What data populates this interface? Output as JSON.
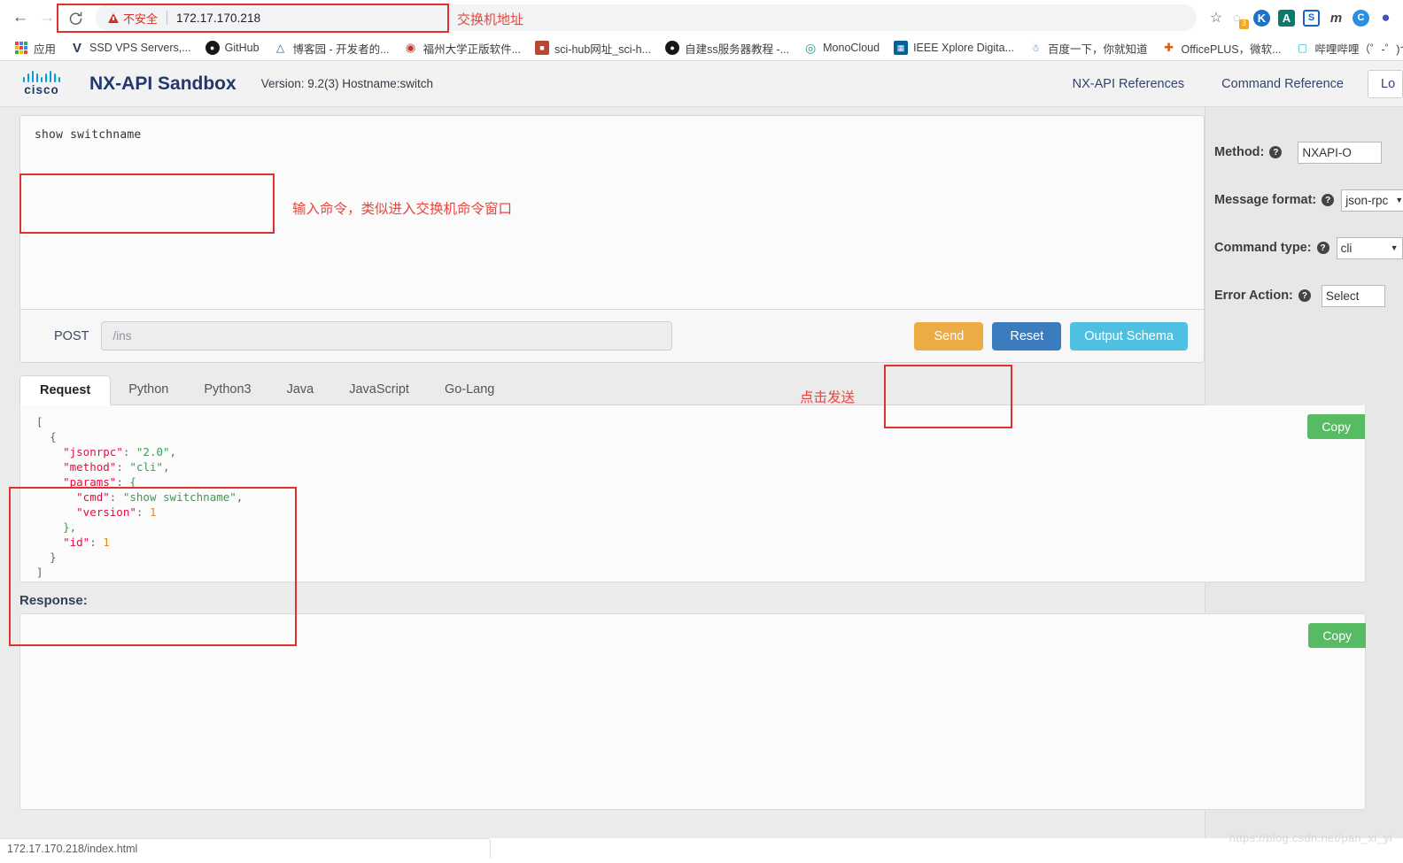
{
  "browser": {
    "back_icon": "back-arrow-icon",
    "forward_icon": "forward-arrow-icon",
    "reload_icon": "reload-icon",
    "security_label": "不安全",
    "url": "172.17.170.218",
    "star_icon": "bookmark-star-icon",
    "extensions": [
      {
        "name": "loading-spinner-extension",
        "glyph": "◌",
        "bg": "#ffffff",
        "fg": "#8a8f94",
        "badge": "3"
      },
      {
        "name": "kaspersky-extension",
        "glyph": "K",
        "bg": "#1a73c8",
        "fg": "#ffffff",
        "badge": ""
      },
      {
        "name": "adblock-extension",
        "glyph": "A",
        "bg": "#0b7a6e",
        "fg": "#ffffff",
        "badge": ""
      },
      {
        "name": "sogou-extension",
        "glyph": "S",
        "bg": "#ffffff",
        "fg": "#1a63bf",
        "badge": ""
      },
      {
        "name": "mendeley-extension",
        "glyph": "m",
        "bg": "#ffffff",
        "fg": "#444444",
        "badge": ""
      },
      {
        "name": "translate-extension",
        "glyph": "C",
        "bg": "#2a8fe0",
        "fg": "#ffffff",
        "badge": ""
      },
      {
        "name": "profile-avatar",
        "glyph": "●",
        "bg": "#ffffff",
        "fg": "#4b4fc4",
        "badge": ""
      }
    ],
    "bookmarks": [
      {
        "label": "应用",
        "icon": "apps-grid-icon",
        "glyph": "",
        "bg": "",
        "fg": ""
      },
      {
        "label": "SSD VPS Servers,...",
        "icon": "vultr-icon",
        "glyph": "V",
        "bg": "#ffffff",
        "fg": "#2b3a55"
      },
      {
        "label": "GitHub",
        "icon": "github-icon",
        "glyph": "●",
        "bg": "#ffffff",
        "fg": "#181717"
      },
      {
        "label": "博客园 - 开发者的...",
        "icon": "cnblogs-icon",
        "glyph": "A",
        "bg": "#ffffff",
        "fg": "#2e5b8f"
      },
      {
        "label": "福州大学正版软件...",
        "icon": "fzu-icon",
        "glyph": "◉",
        "bg": "#ffffff",
        "fg": "#c0392b"
      },
      {
        "label": "sci-hub网址_sci-h...",
        "icon": "scihub-icon",
        "glyph": "▣",
        "bg": "#c0392b",
        "fg": "#ffffff"
      },
      {
        "label": "自建ss服务器教程 -...",
        "icon": "github-icon",
        "glyph": "●",
        "bg": "#ffffff",
        "fg": "#181717"
      },
      {
        "label": "MonoCloud",
        "icon": "monocloud-icon",
        "glyph": "◎",
        "bg": "#ffffff",
        "fg": "#18a48c"
      },
      {
        "label": "IEEE Xplore Digita...",
        "icon": "ieee-icon",
        "glyph": "▦",
        "bg": "#00629b",
        "fg": "#ffffff"
      },
      {
        "label": "百度一下，你就知道",
        "icon": "baidu-icon",
        "glyph": "熊",
        "bg": "#ffffff",
        "fg": "#2b6ecb"
      },
      {
        "label": "OfficePLUS，微软...",
        "icon": "officeplus-icon",
        "glyph": "✛",
        "bg": "#ffffff",
        "fg": "#e05a12"
      },
      {
        "label": "哔哩哔哩（゜-゜)つ",
        "icon": "bilibili-icon",
        "glyph": "▭",
        "bg": "#ffffff",
        "fg": "#2bb7d6"
      }
    ]
  },
  "app": {
    "logo_word": "cisco",
    "title": "NX-API Sandbox",
    "meta": "Version: 9.2(3)  Hostname:switch",
    "nav": [
      {
        "label": "NX-API References"
      },
      {
        "label": "Command Reference"
      }
    ],
    "logout_label": "Lo"
  },
  "command": {
    "text": "show switchname"
  },
  "request_bar": {
    "verb": "POST",
    "endpoint_placeholder": "/ins",
    "send_label": "Send",
    "reset_label": "Reset",
    "schema_label": "Output Schema"
  },
  "options": {
    "method": {
      "label": "Method:",
      "value": "NXAPI-O"
    },
    "message_format": {
      "label": "Message format:",
      "value": "json-rpc"
    },
    "command_type": {
      "label": "Command type:",
      "value": "cli"
    },
    "error_action": {
      "label": "Error Action:",
      "value": "Select"
    }
  },
  "tabs": [
    {
      "label": "Request",
      "active": true
    },
    {
      "label": "Python",
      "active": false
    },
    {
      "label": "Python3",
      "active": false
    },
    {
      "label": "Java",
      "active": false
    },
    {
      "label": "JavaScript",
      "active": false
    },
    {
      "label": "Go-Lang",
      "active": false
    }
  ],
  "request_code": {
    "copy_label": "Copy",
    "lines": [
      {
        "indent": 0,
        "parts": [
          {
            "t": "[",
            "c": "p"
          }
        ]
      },
      {
        "indent": 1,
        "parts": [
          {
            "t": "{",
            "c": "p"
          }
        ]
      },
      {
        "indent": 2,
        "parts": [
          {
            "t": "\"jsonrpc\"",
            "c": "k"
          },
          {
            "t": ": ",
            "c": "p"
          },
          {
            "t": "\"2.0\"",
            "c": "s"
          },
          {
            "t": ",",
            "c": "p"
          }
        ]
      },
      {
        "indent": 2,
        "parts": [
          {
            "t": "\"method\"",
            "c": "k"
          },
          {
            "t": ": ",
            "c": "p"
          },
          {
            "t": "\"cli\"",
            "c": "s"
          },
          {
            "t": ",",
            "c": "p"
          }
        ]
      },
      {
        "indent": 2,
        "parts": [
          {
            "t": "\"params\"",
            "c": "k"
          },
          {
            "t": ": ",
            "c": "p"
          },
          {
            "t": "{",
            "c": "g"
          }
        ]
      },
      {
        "indent": 3,
        "parts": [
          {
            "t": "\"cmd\"",
            "c": "k"
          },
          {
            "t": ": ",
            "c": "p"
          },
          {
            "t": "\"show switchname\"",
            "c": "s"
          },
          {
            "t": ",",
            "c": "p"
          }
        ]
      },
      {
        "indent": 3,
        "parts": [
          {
            "t": "\"version\"",
            "c": "k"
          },
          {
            "t": ": ",
            "c": "p"
          },
          {
            "t": "1",
            "c": "n"
          }
        ]
      },
      {
        "indent": 2,
        "parts": [
          {
            "t": "},",
            "c": "g"
          }
        ]
      },
      {
        "indent": 2,
        "parts": [
          {
            "t": "\"id\"",
            "c": "k"
          },
          {
            "t": ": ",
            "c": "p"
          },
          {
            "t": "1",
            "c": "n"
          }
        ]
      },
      {
        "indent": 1,
        "parts": [
          {
            "t": "}",
            "c": "p"
          }
        ]
      },
      {
        "indent": 0,
        "parts": [
          {
            "t": "]",
            "c": "p"
          }
        ]
      }
    ]
  },
  "response": {
    "label": "Response:",
    "copy_label": "Copy",
    "body": ""
  },
  "annotations": [
    {
      "name": "address-annotation",
      "text": "交换机地址"
    },
    {
      "name": "command-annotation",
      "text": "输入命令，类似进入交换机命令窗口"
    },
    {
      "name": "send-annotation",
      "text": "点击发送"
    }
  ],
  "statusbar": {
    "url": "172.17.170.218/index.html"
  },
  "watermark": "https://blog.csdn.net/pan_xi_yi",
  "colors": {
    "accent_send": "#edab45",
    "accent_reset": "#3a7cbe",
    "accent_schema": "#4fc0e2",
    "accent_copy": "#57bb63",
    "annotation_red": "#e03131",
    "cisco_blue": "#049fd9",
    "insecure_red": "#d93025"
  }
}
